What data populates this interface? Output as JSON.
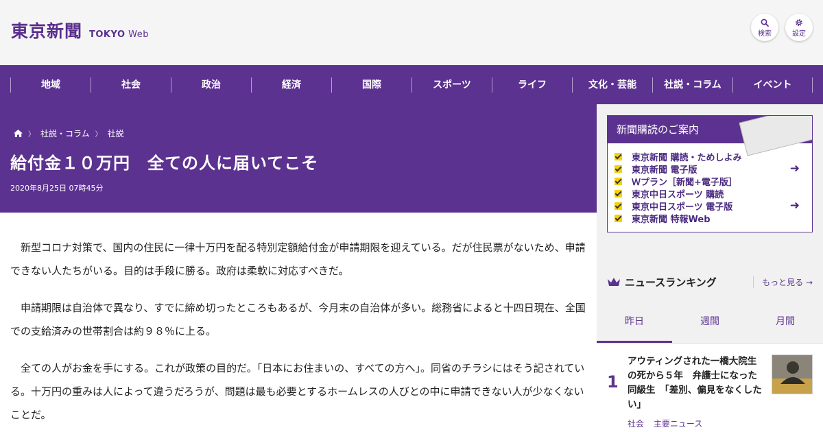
{
  "header": {
    "logo_kanji": "東京新聞",
    "logo_en_bold": "TOKYO",
    "logo_en_light": "Web",
    "search_label": "検索",
    "settings_label": "設定"
  },
  "nav": {
    "items": [
      "地域",
      "社会",
      "政治",
      "経済",
      "国際",
      "スポーツ",
      "ライフ",
      "文化・芸能",
      "社説・コラム",
      "イベント"
    ]
  },
  "breadcrumb": {
    "items": [
      "社説・コラム",
      "社説"
    ]
  },
  "article": {
    "title": "給付金１０万円　全ての人に届いてこそ",
    "date": "2020年8月25日 07時45分",
    "paragraphs": [
      "新型コロナ対策で、国内の住民に一律十万円を配る特別定額給付金が申請期限を迎えている。だが住民票がないため、申請できない人たちがいる。目的は手段に勝る。政府は柔軟に対応すべきだ。",
      "申請期限は自治体で異なり、すでに締め切ったところもあるが、今月末の自治体が多い。総務省によると十四日現在、全国での支給済みの世帯割合は約９８％に上る。",
      "全ての人がお金を手にする。これが政策の目的だ。「日本にお住まいの、すべての方へ」。同省のチラシにはそう記されている。十万円の重みは人によって違うだろうが、問題は最も必要とするホームレスの人びとの中に申請できない人が少なくないことだ。"
    ]
  },
  "subscribe": {
    "title": "新聞購読のご案内",
    "items": [
      "東京新聞 購読・ためしよみ",
      "東京新聞 電子版",
      "Ｗプラン［新聞+電子版］",
      "東京中日スポーツ 購読",
      "東京中日スポーツ 電子版",
      "東京新聞 特報Web"
    ]
  },
  "ranking": {
    "title": "ニュースランキング",
    "more_label": "もっと見る",
    "tabs": [
      "昨日",
      "週間",
      "月間"
    ],
    "items": [
      {
        "rank": "1",
        "text": "アウティングされた一橋大院生の死から５年　弁護士になった同級生　「差別、偏見をなくしたい」",
        "tags": [
          "社会",
          "主要ニュース"
        ]
      }
    ]
  },
  "colors": {
    "brand_purple": "#5c3290",
    "check_yellow": "#f6d200"
  }
}
